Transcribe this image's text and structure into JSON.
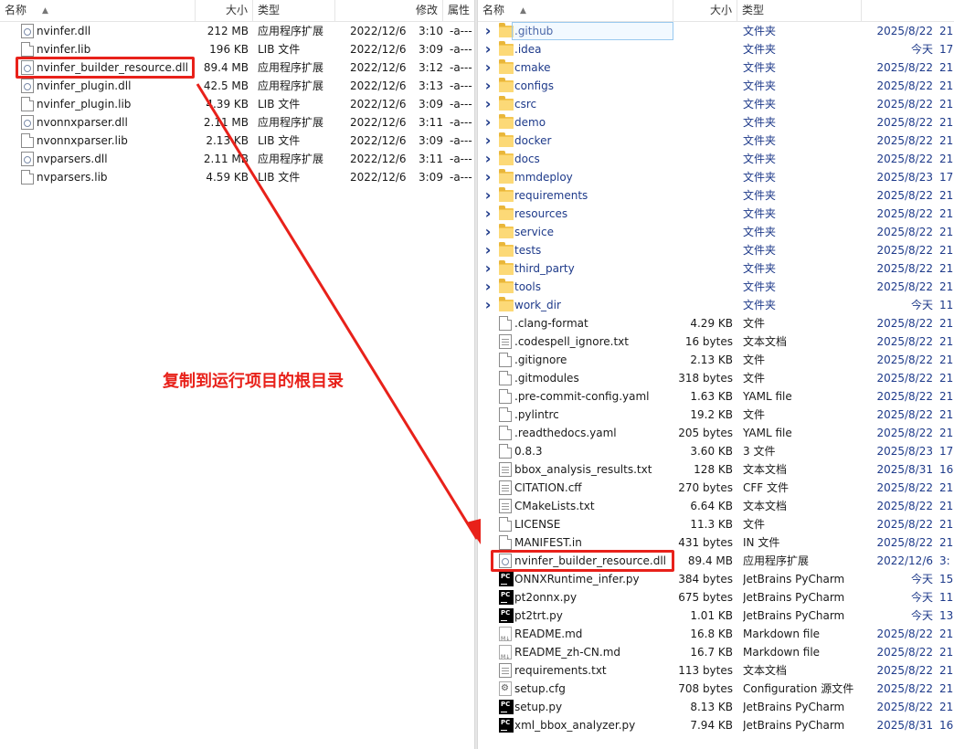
{
  "left_pane": {
    "headers": {
      "name": "名称",
      "size": "大小",
      "type": "类型",
      "modified": "修改",
      "attr": "属性"
    },
    "rows": [
      {
        "name": "nvinfer.dll",
        "size": "212 MB",
        "type": "应用程序扩展",
        "date": "2022/12/6",
        "time": "3:10",
        "attr": "-a---",
        "icon": "dll-icon"
      },
      {
        "name": "nvinfer.lib",
        "size": "196 KB",
        "type": "LIB 文件",
        "date": "2022/12/6",
        "time": "3:09",
        "attr": "-a---",
        "icon": "file-icon"
      },
      {
        "name": "nvinfer_builder_resource.dll",
        "size": "89.4 MB",
        "type": "应用程序扩展",
        "date": "2022/12/6",
        "time": "3:12",
        "attr": "-a---",
        "icon": "dll-icon"
      },
      {
        "name": "nvinfer_plugin.dll",
        "size": "42.5 MB",
        "type": "应用程序扩展",
        "date": "2022/12/6",
        "time": "3:13",
        "attr": "-a---",
        "icon": "dll-icon"
      },
      {
        "name": "nvinfer_plugin.lib",
        "size": "4.39 KB",
        "type": "LIB 文件",
        "date": "2022/12/6",
        "time": "3:09",
        "attr": "-a---",
        "icon": "file-icon"
      },
      {
        "name": "nvonnxparser.dll",
        "size": "2.11 MB",
        "type": "应用程序扩展",
        "date": "2022/12/6",
        "time": "3:11",
        "attr": "-a---",
        "icon": "dll-icon"
      },
      {
        "name": "nvonnxparser.lib",
        "size": "2.13 KB",
        "type": "LIB 文件",
        "date": "2022/12/6",
        "time": "3:09",
        "attr": "-a---",
        "icon": "file-icon"
      },
      {
        "name": "nvparsers.dll",
        "size": "2.11 MB",
        "type": "应用程序扩展",
        "date": "2022/12/6",
        "time": "3:11",
        "attr": "-a---",
        "icon": "dll-icon"
      },
      {
        "name": "nvparsers.lib",
        "size": "4.59 KB",
        "type": "LIB 文件",
        "date": "2022/12/6",
        "time": "3:09",
        "attr": "-a---",
        "icon": "file-icon"
      }
    ]
  },
  "right_pane": {
    "headers": {
      "name": "名称",
      "size": "大小",
      "type": "类型"
    },
    "rows": [
      {
        "name": ".github",
        "size": "",
        "type": "文件夹",
        "date": "2025/8/22",
        "time": "21:",
        "icon": "folder-icon",
        "folder": true
      },
      {
        "name": ".idea",
        "size": "",
        "type": "文件夹",
        "date": "今天",
        "time": "17:",
        "icon": "folder-icon",
        "folder": true
      },
      {
        "name": "cmake",
        "size": "",
        "type": "文件夹",
        "date": "2025/8/22",
        "time": "21:",
        "icon": "folder-icon",
        "folder": true
      },
      {
        "name": "configs",
        "size": "",
        "type": "文件夹",
        "date": "2025/8/22",
        "time": "21:",
        "icon": "folder-icon",
        "folder": true
      },
      {
        "name": "csrc",
        "size": "",
        "type": "文件夹",
        "date": "2025/8/22",
        "time": "21:",
        "icon": "folder-icon",
        "folder": true
      },
      {
        "name": "demo",
        "size": "",
        "type": "文件夹",
        "date": "2025/8/22",
        "time": "21:",
        "icon": "folder-icon",
        "folder": true
      },
      {
        "name": "docker",
        "size": "",
        "type": "文件夹",
        "date": "2025/8/22",
        "time": "21:",
        "icon": "folder-icon",
        "folder": true
      },
      {
        "name": "docs",
        "size": "",
        "type": "文件夹",
        "date": "2025/8/22",
        "time": "21:",
        "icon": "folder-icon",
        "folder": true
      },
      {
        "name": "mmdeploy",
        "size": "",
        "type": "文件夹",
        "date": "2025/8/23",
        "time": "17:",
        "icon": "folder-icon",
        "folder": true
      },
      {
        "name": "requirements",
        "size": "",
        "type": "文件夹",
        "date": "2025/8/22",
        "time": "21:",
        "icon": "folder-icon",
        "folder": true
      },
      {
        "name": "resources",
        "size": "",
        "type": "文件夹",
        "date": "2025/8/22",
        "time": "21:",
        "icon": "folder-icon",
        "folder": true
      },
      {
        "name": "service",
        "size": "",
        "type": "文件夹",
        "date": "2025/8/22",
        "time": "21:",
        "icon": "folder-icon",
        "folder": true
      },
      {
        "name": "tests",
        "size": "",
        "type": "文件夹",
        "date": "2025/8/22",
        "time": "21:",
        "icon": "folder-icon",
        "folder": true
      },
      {
        "name": "third_party",
        "size": "",
        "type": "文件夹",
        "date": "2025/8/22",
        "time": "21:",
        "icon": "folder-icon",
        "folder": true
      },
      {
        "name": "tools",
        "size": "",
        "type": "文件夹",
        "date": "2025/8/22",
        "time": "21:",
        "icon": "folder-icon",
        "folder": true
      },
      {
        "name": "work_dir",
        "size": "",
        "type": "文件夹",
        "date": "今天",
        "time": "11:",
        "icon": "folder-icon",
        "folder": true
      },
      {
        "name": ".clang-format",
        "size": "4.29 KB",
        "type": "文件",
        "date": "2025/8/22",
        "time": "21:",
        "icon": "file-icon"
      },
      {
        "name": ".codespell_ignore.txt",
        "size": "16 bytes",
        "type": "文本文档",
        "date": "2025/8/22",
        "time": "21:",
        "icon": "text-doc-icon"
      },
      {
        "name": ".gitignore",
        "size": "2.13 KB",
        "type": "文件",
        "date": "2025/8/22",
        "time": "21:",
        "icon": "file-icon"
      },
      {
        "name": ".gitmodules",
        "size": "318 bytes",
        "type": "文件",
        "date": "2025/8/22",
        "time": "21:",
        "icon": "file-icon"
      },
      {
        "name": ".pre-commit-config.yaml",
        "size": "1.63 KB",
        "type": "YAML file",
        "date": "2025/8/22",
        "time": "21:",
        "icon": "file-icon"
      },
      {
        "name": ".pylintrc",
        "size": "19.2 KB",
        "type": "文件",
        "date": "2025/8/22",
        "time": "21:",
        "icon": "file-icon"
      },
      {
        "name": ".readthedocs.yaml",
        "size": "205 bytes",
        "type": "YAML file",
        "date": "2025/8/22",
        "time": "21:",
        "icon": "file-icon"
      },
      {
        "name": "0.8.3",
        "size": "3.60 KB",
        "type": "3 文件",
        "date": "2025/8/23",
        "time": "17:",
        "icon": "file-icon"
      },
      {
        "name": "bbox_analysis_results.txt",
        "size": "128 KB",
        "type": "文本文档",
        "date": "2025/8/31",
        "time": "16:",
        "icon": "text-doc-icon"
      },
      {
        "name": "CITATION.cff",
        "size": "270 bytes",
        "type": "CFF 文件",
        "date": "2025/8/22",
        "time": "21:",
        "icon": "text-doc-icon"
      },
      {
        "name": "CMakeLists.txt",
        "size": "6.64 KB",
        "type": "文本文档",
        "date": "2025/8/22",
        "time": "21:",
        "icon": "text-doc-icon"
      },
      {
        "name": "LICENSE",
        "size": "11.3 KB",
        "type": "文件",
        "date": "2025/8/22",
        "time": "21:",
        "icon": "file-icon"
      },
      {
        "name": "MANIFEST.in",
        "size": "431 bytes",
        "type": "IN 文件",
        "date": "2025/8/22",
        "time": "21:",
        "icon": "file-icon"
      },
      {
        "name": "nvinfer_builder_resource.dll",
        "size": "89.4 MB",
        "type": "应用程序扩展",
        "date": "2022/12/6",
        "time": "3:",
        "icon": "dll-icon"
      },
      {
        "name": "ONNXRuntime_infer.py",
        "size": "384 bytes",
        "type": "JetBrains PyCharm",
        "date": "今天",
        "time": "15:",
        "icon": "pycharm-icon"
      },
      {
        "name": "pt2onnx.py",
        "size": "675 bytes",
        "type": "JetBrains PyCharm",
        "date": "今天",
        "time": "11:",
        "icon": "pycharm-icon"
      },
      {
        "name": "pt2trt.py",
        "size": "1.01 KB",
        "type": "JetBrains PyCharm",
        "date": "今天",
        "time": "13:",
        "icon": "pycharm-icon"
      },
      {
        "name": "README.md",
        "size": "16.8 KB",
        "type": "Markdown file",
        "date": "2025/8/22",
        "time": "21:",
        "icon": "markdown-icon"
      },
      {
        "name": "README_zh-CN.md",
        "size": "16.7 KB",
        "type": "Markdown file",
        "date": "2025/8/22",
        "time": "21:",
        "icon": "markdown-icon"
      },
      {
        "name": "requirements.txt",
        "size": "113 bytes",
        "type": "文本文档",
        "date": "2025/8/22",
        "time": "21:",
        "icon": "text-doc-icon"
      },
      {
        "name": "setup.cfg",
        "size": "708 bytes",
        "type": "Configuration 源文件",
        "date": "2025/8/22",
        "time": "21:",
        "icon": "settings-file-icon"
      },
      {
        "name": "setup.py",
        "size": "8.13 KB",
        "type": "JetBrains PyCharm",
        "date": "2025/8/22",
        "time": "21:",
        "icon": "pycharm-icon"
      },
      {
        "name": "xml_bbox_analyzer.py",
        "size": "7.94 KB",
        "type": "JetBrains PyCharm",
        "date": "2025/8/31",
        "time": "16:",
        "icon": "pycharm-icon"
      }
    ]
  },
  "annotation": {
    "text": "复制到运行项目的根目录",
    "color": "#e8211a"
  },
  "colors": {
    "accent_red": "#e8211a",
    "folder_text": "#1e3a8a",
    "folder_yellow": "#f4c650"
  }
}
